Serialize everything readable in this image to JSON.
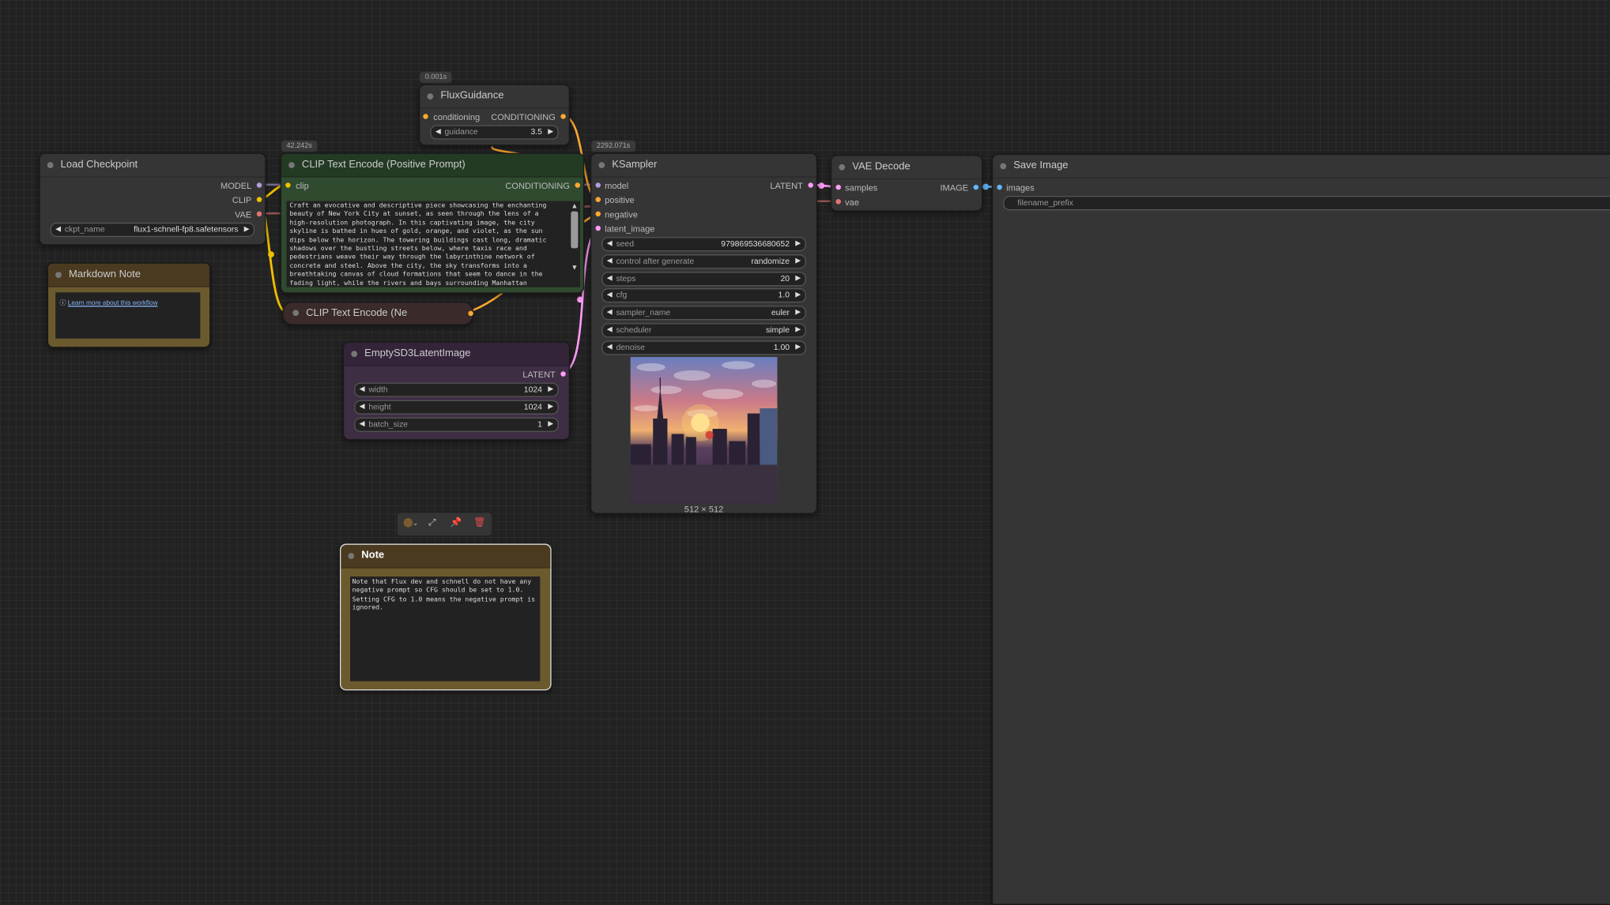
{
  "colors": {
    "wire_clip": "#f0c000",
    "wire_model": "#b39ddb",
    "wire_vae": "#e57373",
    "wire_conditioning": "#ffa931",
    "wire_latent": "#ff9cf9",
    "wire_image": "#64b5f6"
  },
  "nodes": {
    "flux_guidance": {
      "timing": "0.001s",
      "title": "FluxGuidance",
      "input": "conditioning",
      "output": "CONDITIONING",
      "guidance_label": "guidance",
      "guidance_value": "3.5"
    },
    "load_checkpoint": {
      "title": "Load Checkpoint",
      "outputs": [
        "MODEL",
        "CLIP",
        "VAE"
      ],
      "ckpt_label": "ckpt_name",
      "ckpt_value": "flux1-schnell-fp8.safetensors"
    },
    "clip_positive": {
      "timing": "42.242s",
      "title": "CLIP Text Encode (Positive Prompt)",
      "input": "clip",
      "output": "CONDITIONING",
      "text": "Craft an evocative and descriptive piece showcasing the enchanting\nbeauty of New York City at sunset, as seen through the lens of a\nhigh-resolution photograph. In this captivating image, the city\nskyline is bathed in hues of gold, orange, and violet, as the sun\ndips below the horizon. The towering buildings cast long, dramatic\nshadows over the bustling streets below, where taxis race and\npedestrians weave their way through the labyrinthine network of\nconcrete and steel. Above the city, the sky transforms into a\nbreathtaking canvas of cloud formations that seem to dance in the\nfading light, while the rivers and bays surrounding Manhattan"
    },
    "clip_negative": {
      "title": "CLIP Text Encode (Ne"
    },
    "markdown_note": {
      "title": "Markdown Note",
      "link": "Learn more about this workflow",
      "info_icon": "ⓘ"
    },
    "empty_latent": {
      "title": "EmptySD3LatentImage",
      "output": "LATENT",
      "widgets": [
        {
          "label": "width",
          "value": "1024"
        },
        {
          "label": "height",
          "value": "1024"
        },
        {
          "label": "batch_size",
          "value": "1"
        }
      ]
    },
    "ksampler": {
      "timing": "2292.071s",
      "title": "KSampler",
      "inputs": [
        "model",
        "positive",
        "negative",
        "latent_image"
      ],
      "output": "LATENT",
      "widgets": [
        {
          "label": "seed",
          "value": "979869536680652"
        },
        {
          "label": "control after generate",
          "value": "randomize"
        },
        {
          "label": "steps",
          "value": "20"
        },
        {
          "label": "cfg",
          "value": "1.0"
        },
        {
          "label": "sampler_name",
          "value": "euler"
        },
        {
          "label": "scheduler",
          "value": "simple"
        },
        {
          "label": "denoise",
          "value": "1.00"
        }
      ],
      "image_size": "512 × 512"
    },
    "vae_decode": {
      "title": "VAE Decode",
      "inputs": [
        "samples",
        "vae"
      ],
      "output": "IMAGE"
    },
    "save_image": {
      "title": "Save Image",
      "input": "images",
      "prefix_placeholder": "filename_prefix"
    },
    "note": {
      "title": "Note",
      "text": "Note that Flux dev and schnell do not have any\nnegative prompt so CFG should be set to 1.0.\nSetting CFG to 1.0 means the negative prompt is\nignored."
    }
  },
  "toolbar": {
    "color_icon": "color-picker-icon",
    "bypass_icon": "wand-icon",
    "pin_icon": "pin-icon",
    "delete_icon": "trash-icon"
  }
}
